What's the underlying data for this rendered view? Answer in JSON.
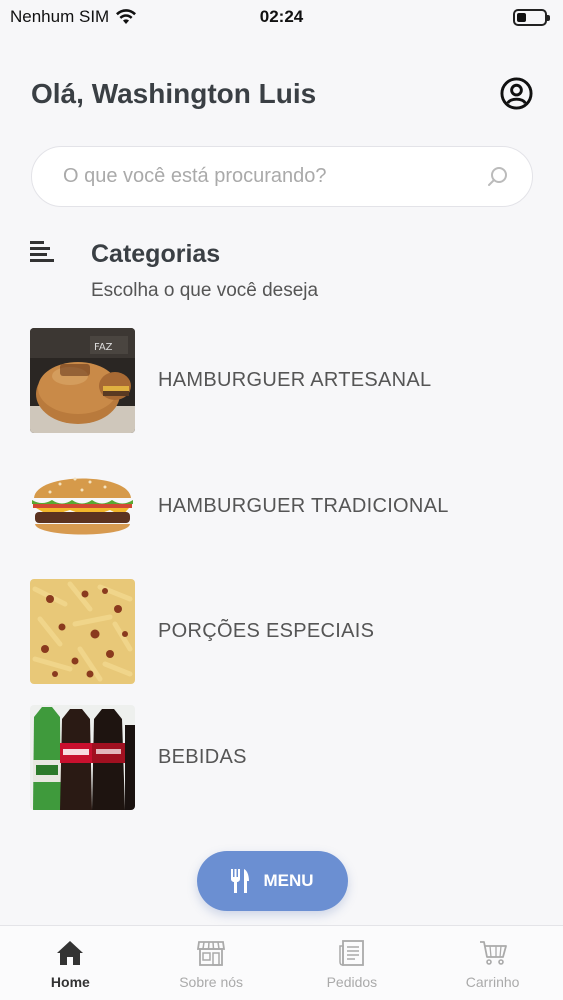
{
  "status_bar": {
    "carrier": "Nenhum SIM",
    "time": "02:24"
  },
  "header": {
    "greeting": "Olá, Washington Luis"
  },
  "search": {
    "placeholder": "O que você está procurando?",
    "value": ""
  },
  "categories": {
    "title": "Categorias",
    "subtitle": "Escolha o que você deseja",
    "items": [
      {
        "label": "HAMBURGUER ARTESANAL",
        "image": "artisan-burger-photo"
      },
      {
        "label": "HAMBURGUER TRADICIONAL",
        "image": "traditional-burger-photo"
      },
      {
        "label": "PORÇÕES ESPECIAIS",
        "image": "fries-portion-photo"
      },
      {
        "label": "BEBIDAS",
        "image": "soda-bottles-photo"
      }
    ]
  },
  "menu_button": {
    "label": "MENU",
    "color": "#6b8fd2"
  },
  "tabbar": {
    "tabs": [
      {
        "label": "Home",
        "icon": "home-icon",
        "active": true
      },
      {
        "label": "Sobre nós",
        "icon": "store-icon",
        "active": false
      },
      {
        "label": "Pedidos",
        "icon": "receipt-icon",
        "active": false
      },
      {
        "label": "Carrinho",
        "icon": "cart-icon",
        "active": false
      }
    ]
  }
}
